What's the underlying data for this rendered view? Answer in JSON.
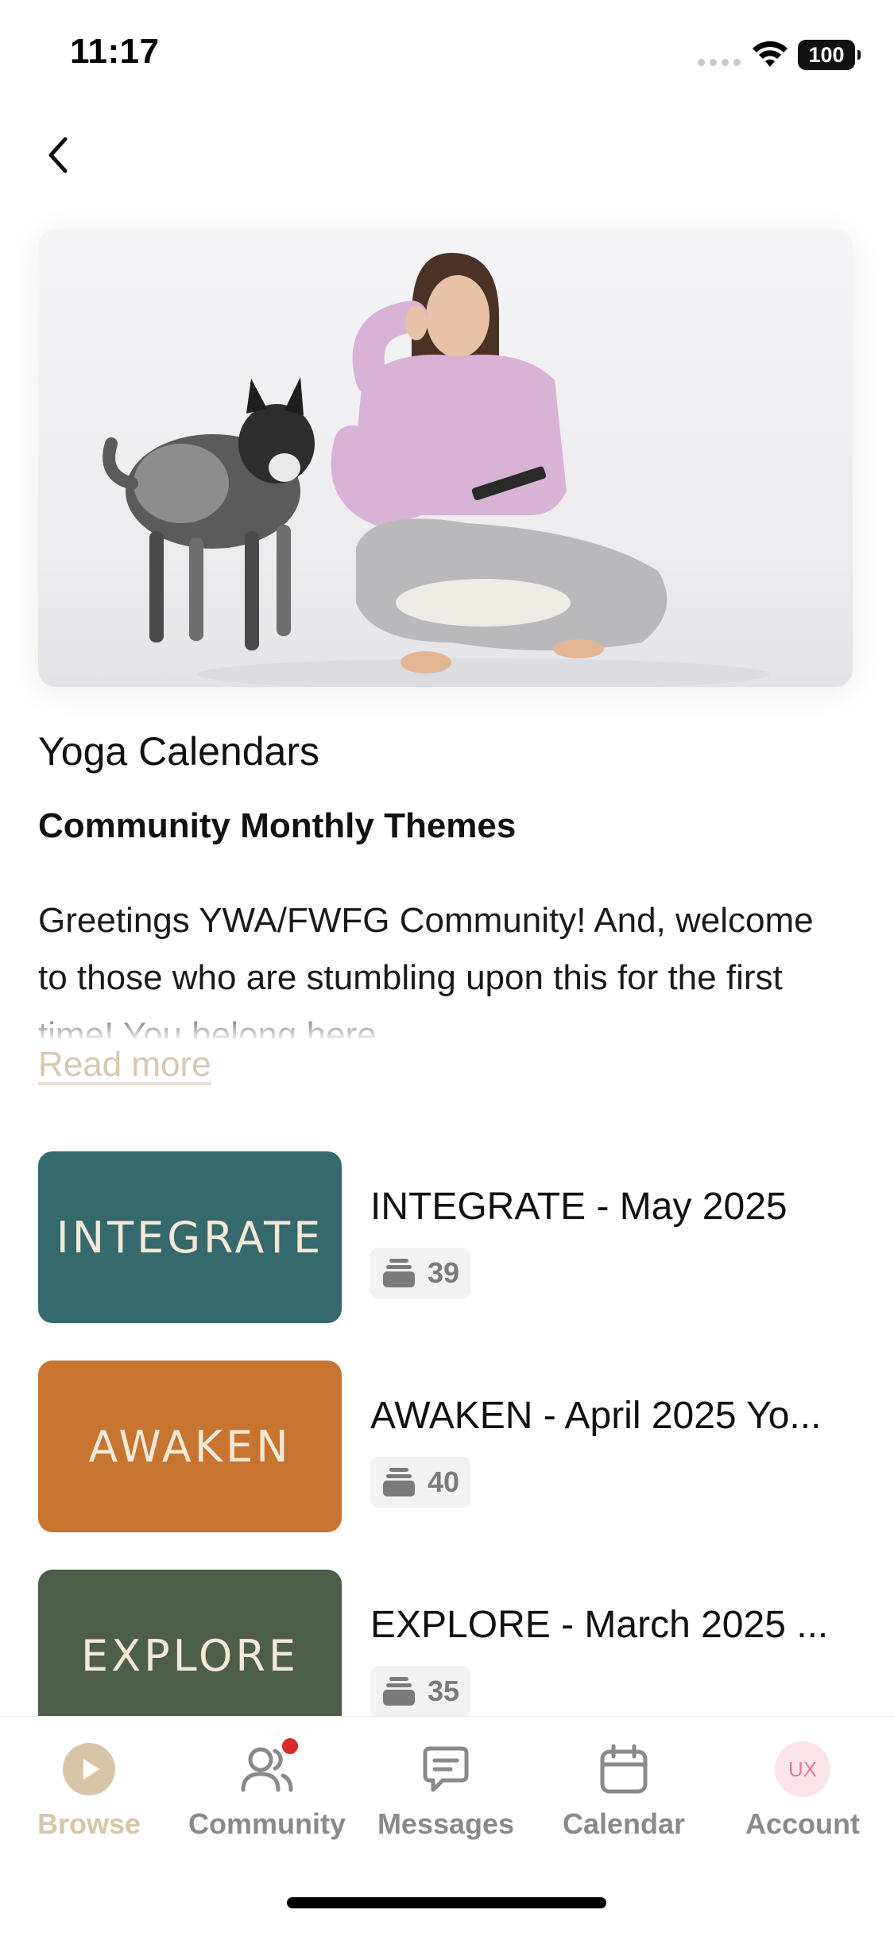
{
  "status_bar": {
    "time": "11:17",
    "battery": "100"
  },
  "header": {
    "back_label": "Back"
  },
  "hero": {
    "image_alt": "Woman sitting cross-legged on a cushion reading a notebook next to a spotted dog"
  },
  "page": {
    "title": "Yoga Calendars",
    "subtitle": "Community Monthly Themes",
    "description": "Greetings YWA/FWFG Community! And, welcome to those who are stumbling upon this for the first time! You belong here.",
    "read_more": "Read more"
  },
  "items": [
    {
      "thumb_text": "INTEGRATE",
      "thumb_color": "#36696c",
      "title": "INTEGRATE - May 2025",
      "count": "39"
    },
    {
      "thumb_text": "AWAKEN",
      "thumb_color": "#c87431",
      "title": "AWAKEN - April 2025 Yo...",
      "count": "40"
    },
    {
      "thumb_text": "EXPLORE",
      "thumb_color": "#4d5e49",
      "title": "EXPLORE - March 2025 ...",
      "count": "35"
    }
  ],
  "tabs": [
    {
      "label": "Browse",
      "icon": "play-icon",
      "active": true
    },
    {
      "label": "Community",
      "icon": "people-icon",
      "active": false
    },
    {
      "label": "Messages",
      "icon": "message-icon",
      "active": false
    },
    {
      "label": "Calendar",
      "icon": "calendar-icon",
      "active": false
    },
    {
      "label": "Account",
      "icon": "avatar",
      "avatar_initials": "UX",
      "active": false
    }
  ],
  "colors": {
    "accent": "#d8c5a8",
    "notification": "#d92b2b",
    "muted": "#8a8a8a"
  }
}
